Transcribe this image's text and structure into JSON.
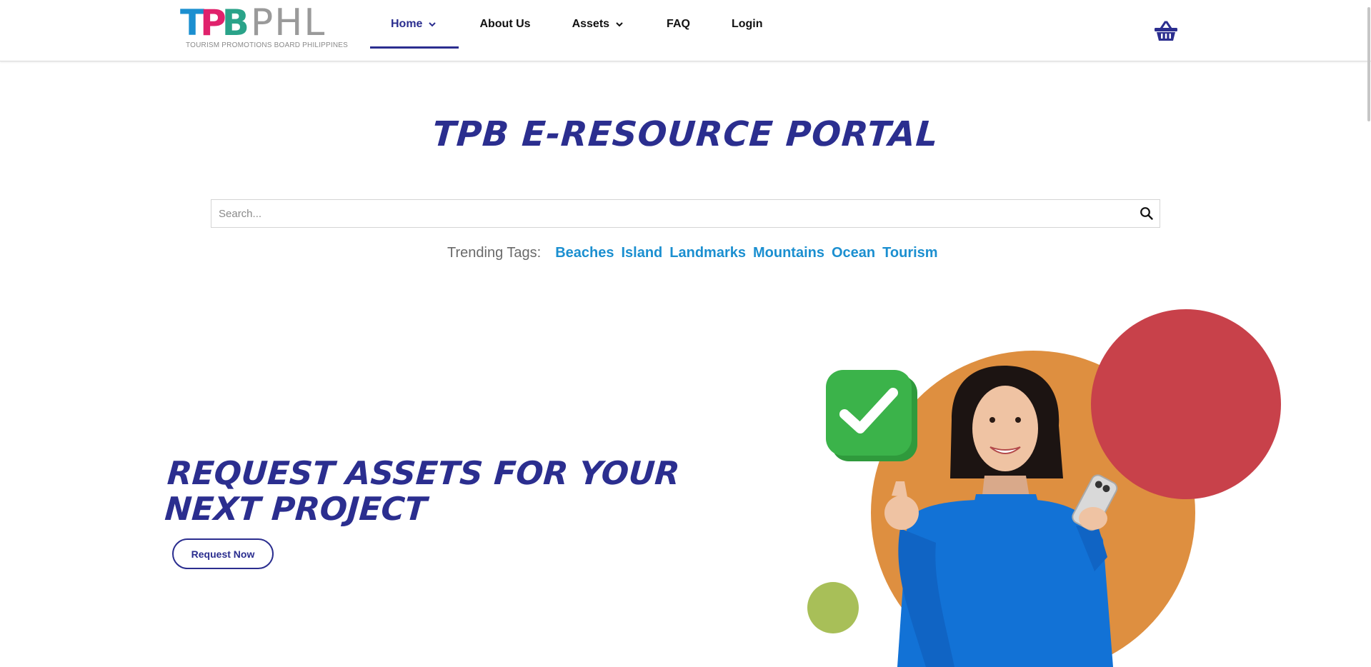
{
  "header": {
    "logo": {
      "brand_t": "T",
      "brand_p": "P",
      "brand_b": "B",
      "brand_suffix": "PHL",
      "tagline": "TOURISM PROMOTIONS BOARD PHILIPPINES"
    },
    "nav": [
      {
        "label": "Home",
        "has_dropdown": true,
        "active": true
      },
      {
        "label": "About Us",
        "has_dropdown": false
      },
      {
        "label": "Assets",
        "has_dropdown": true
      },
      {
        "label": "FAQ",
        "has_dropdown": false
      },
      {
        "label": "Login",
        "has_dropdown": false
      }
    ],
    "cart_icon": "shopping-basket-icon"
  },
  "main": {
    "title": "TPB E-RESOURCE PORTAL",
    "search": {
      "placeholder": "Search...",
      "value": "",
      "icon": "search-icon"
    },
    "trending": {
      "label": "Trending Tags:",
      "tags": [
        "Beaches",
        "Island",
        "Landmarks",
        "Mountains",
        "Ocean",
        "Tourism"
      ]
    },
    "hero": {
      "title_line1": "REQUEST ASSETS FOR YOUR",
      "title_line2": "NEXT PROJECT",
      "button_label": "Request Now"
    }
  },
  "colors": {
    "brand_navy": "#2b2e8f",
    "tag_blue": "#1b8fd0",
    "circle_orange": "#de8f40",
    "circle_red": "#c8414a",
    "circle_green": "#a8bf58",
    "check_green": "#3bb34a",
    "sweater_blue": "#1272d6"
  }
}
